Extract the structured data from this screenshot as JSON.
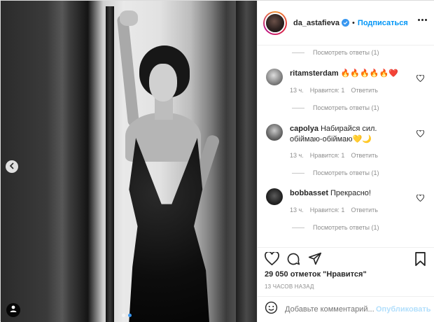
{
  "post": {
    "username": "da_astafieva",
    "separator": "•",
    "follow_label": "Подписаться",
    "likes_text": "29 050 отметок \"Нравится\"",
    "time_text": "13 ЧАСОВ НАЗАД",
    "comment_placeholder": "Добавьте комментарий...",
    "post_label": "Опубликовать",
    "carousel": {
      "slides": 2,
      "active": 2
    }
  },
  "comments": [
    {
      "view_replies": "Посмотреть ответы (1)"
    },
    {
      "username": "ritamsterdam",
      "text": "🔥🔥🔥🔥🔥❤️",
      "time": "13 ч.",
      "likes": "Нравится: 1",
      "reply": "Ответить",
      "view_replies": "Посмотреть ответы (1)"
    },
    {
      "username": "capolya",
      "text": "Набирайся сил. обіймаю-обіймаю💛🌙",
      "time": "13 ч.",
      "likes": "Нравится: 1",
      "reply": "Ответить",
      "view_replies": "Посмотреть ответы (1)"
    },
    {
      "username": "bobbasset",
      "text": "Прекрасно!",
      "time": "13 ч.",
      "likes": "Нравится: 1",
      "reply": "Ответить",
      "view_replies": "Посмотреть ответы (1)"
    }
  ],
  "colors": {
    "accent": "#0095f6",
    "verified": "#3897f0",
    "muted": "#8e8e8e",
    "post_disabled": "#b2dffc"
  },
  "icons": [
    "chevron-left-icon",
    "tag-person-icon",
    "verified-icon",
    "more-icon",
    "heart-icon",
    "comment-icon",
    "share-icon",
    "bookmark-icon",
    "emoji-icon"
  ]
}
